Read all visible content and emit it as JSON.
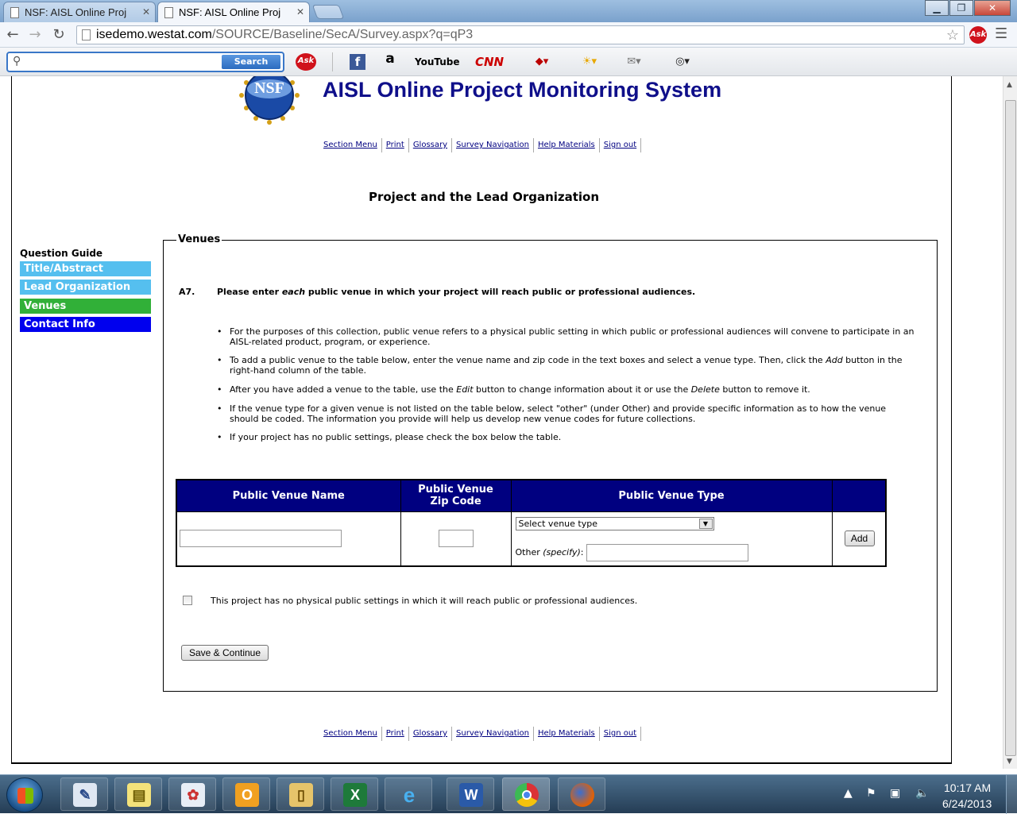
{
  "browser": {
    "tabs": [
      {
        "label": "NSF: AISL Online Proj",
        "active": false
      },
      {
        "label": "NSF: AISL Online Proj",
        "active": true
      }
    ],
    "url_host": "isedemo.westat.com",
    "url_path": "/SOURCE/Baseline/SecA/Survey.aspx?q=qP3",
    "ask_badge": "Ask"
  },
  "toolbar": {
    "search_button": "Search",
    "search_value": "",
    "icons": [
      "ask-logo-icon",
      "facebook-icon",
      "amazon-icon",
      "youtube-icon",
      "cnn-icon",
      "games-icon",
      "weather-icon",
      "mail-icon",
      "dictionary-icon"
    ],
    "amazon_label": "a",
    "youtube_label": "YouTube",
    "cnn_label": "CNN",
    "facebook_label": "f"
  },
  "header": {
    "logo_text": "NSF",
    "title": "AISL Online Project Monitoring System",
    "links": [
      "Section Menu",
      "Print",
      "Glossary",
      "Survey Navigation",
      "Help Materials",
      "Sign out"
    ]
  },
  "page": {
    "heading": "Project and the Lead Organization"
  },
  "guide": {
    "title": "Question Guide",
    "items": [
      {
        "label": "Title/Abstract",
        "color": "#55bfef"
      },
      {
        "label": "Lead Organization",
        "color": "#55bfef"
      },
      {
        "label": "Venues",
        "color": "#31b038"
      },
      {
        "label": "Contact Info",
        "color": "#0000ee"
      }
    ]
  },
  "venues": {
    "legend": "Venues",
    "question_number": "A7.",
    "question_pre": "Please enter ",
    "question_em": "each",
    "question_post": " public venue in which your project will reach public or professional audiences.",
    "bullets": [
      {
        "text": "For the purposes of this collection, public venue refers to a physical public setting in which public or professional audiences will convene to participate in an AISL-related product, program, or experience."
      },
      {
        "pre": "To add a public venue to the table below, enter the venue name and zip code in the text boxes and select a venue type. Then, click the ",
        "em": "Add",
        "post": " button in the right-hand column of the table."
      },
      {
        "pre": "After you have added a venue to the table, use the ",
        "em": "Edit",
        "mid": " button to change information about it or use the ",
        "em2": "Delete",
        "post": " button to remove it."
      },
      {
        "text": "If the venue type for a given venue is not listed on the table below, select \"other\" (under Other) and provide specific information as to how the venue should be coded. The information you provide will help us develop new venue codes for future collections."
      },
      {
        "text": "If your project has no public settings, please check the box below the table."
      }
    ],
    "table": {
      "headers": [
        "Public Venue Name",
        "Public Venue\nZip Code",
        "Public Venue Type",
        ""
      ],
      "venue_name_value": "",
      "zip_value": "",
      "venue_type_selected": "Select venue type",
      "other_label_pre": "Other ",
      "other_label_em": "(specify)",
      "other_label_post": ":",
      "other_value": "",
      "add_button": "Add"
    },
    "no_public_checked": false,
    "no_public_label": "This project has no physical public settings in which it will reach public or professional audiences.",
    "save_button": "Save & Continue"
  },
  "taskbar": {
    "apps": [
      "task-scheduler-icon",
      "sticky-notes-icon",
      "paint-icon",
      "outlook-icon",
      "explorer-folder-icon",
      "excel-icon",
      "ie-icon",
      "word-icon",
      "chrome-icon",
      "firefox-icon"
    ],
    "time": "10:17 AM",
    "date": "6/24/2013"
  }
}
